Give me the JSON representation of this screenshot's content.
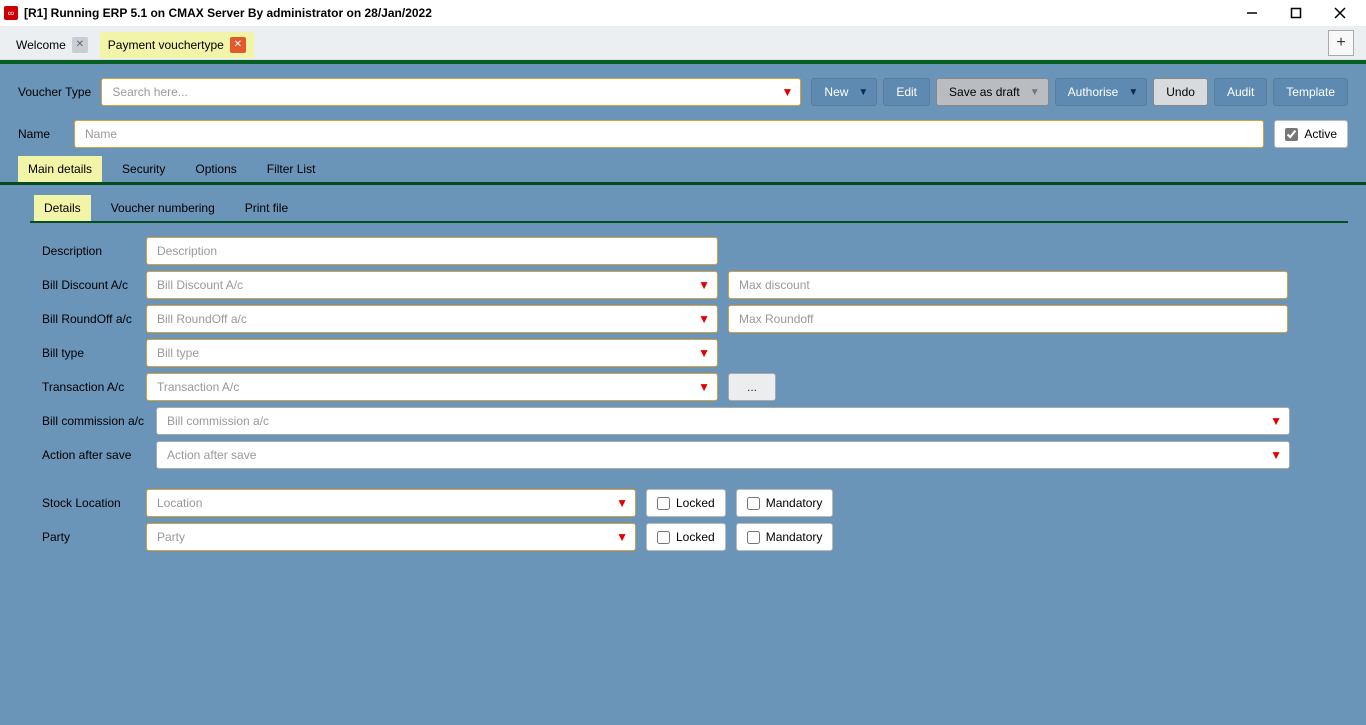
{
  "app": {
    "title": "[R1] Running ERP 5.1 on CMAX Server By administrator on 28/Jan/2022"
  },
  "docTabs": {
    "welcome": "Welcome",
    "payment": "Payment vouchertype",
    "addSymbol": "+"
  },
  "toolbar": {
    "voucherTypeLabel": "Voucher Type",
    "searchPlaceholder": "Search here...",
    "new": "New",
    "edit": "Edit",
    "saveDraft": "Save as draft",
    "authorise": "Authorise",
    "undo": "Undo",
    "audit": "Audit",
    "template": "Template"
  },
  "nameRow": {
    "label": "Name",
    "placeholder": "Name",
    "activeLabel": "Active"
  },
  "innerTabs": {
    "main": "Main details",
    "security": "Security",
    "options": "Options",
    "filter": "Filter List"
  },
  "subTabs": {
    "details": "Details",
    "vnum": "Voucher numbering",
    "print": "Print file"
  },
  "form": {
    "description": {
      "label": "Description",
      "placeholder": "Description"
    },
    "billDiscount": {
      "label": "Bill Discount A/c",
      "placeholder": "Bill Discount A/c",
      "maxPlaceholder": "Max discount"
    },
    "billRoundoff": {
      "label": "Bill RoundOff a/c",
      "placeholder": "Bill RoundOff a/c",
      "maxPlaceholder": "Max Roundoff"
    },
    "billType": {
      "label": "Bill type",
      "placeholder": "Bill type"
    },
    "transaction": {
      "label": "Transaction A/c",
      "placeholder": "Transaction A/c",
      "ellipsis": "..."
    },
    "billCommission": {
      "label": "Bill commission a/c",
      "placeholder": "Bill commission a/c"
    },
    "actionAfterSave": {
      "label": "Action after save",
      "placeholder": "Action after save"
    },
    "stockLocation": {
      "label": "Stock Location",
      "placeholder": "Location",
      "locked": "Locked",
      "mandatory": "Mandatory"
    },
    "party": {
      "label": "Party",
      "placeholder": "Party",
      "locked": "Locked",
      "mandatory": "Mandatory"
    }
  }
}
